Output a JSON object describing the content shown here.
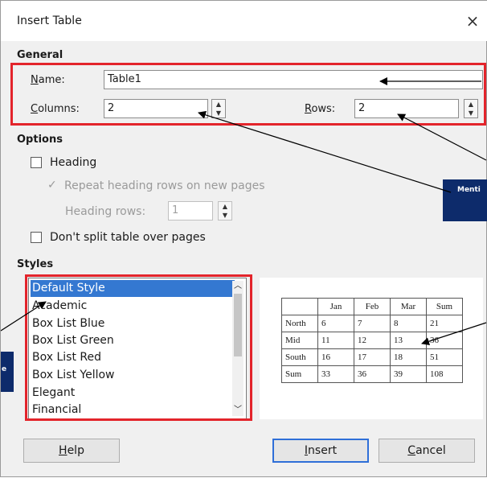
{
  "window": {
    "title": "Insert Table",
    "close_glyph": "×"
  },
  "general": {
    "heading": "General",
    "name_label": "Name:",
    "name_value": "Table1",
    "columns_label": "Columns:",
    "columns_value": "2",
    "rows_label": "Rows:",
    "rows_value": "2"
  },
  "options": {
    "heading": "Options",
    "heading_checkbox": "Heading",
    "repeat_heading": "Repeat heading rows on new pages",
    "heading_rows_label": "Heading rows:",
    "heading_rows_value": "1",
    "dont_split": "Don't split table over pages"
  },
  "styles": {
    "heading": "Styles",
    "items": [
      "Default Style",
      "Academic",
      "Box List Blue",
      "Box List Green",
      "Box List Red",
      "Box List Yellow",
      "Elegant",
      "Financial"
    ],
    "selected": "Default Style"
  },
  "preview_table": {
    "header": [
      "",
      "Jan",
      "Feb",
      "Mar",
      "Sum"
    ],
    "rows": [
      [
        "North",
        "6",
        "7",
        "8",
        "21"
      ],
      [
        "Mid",
        "11",
        "12",
        "13",
        "36"
      ],
      [
        "South",
        "16",
        "17",
        "18",
        "51"
      ],
      [
        "Sum",
        "33",
        "36",
        "39",
        "108"
      ]
    ]
  },
  "buttons": {
    "help": "Help",
    "insert": "Insert",
    "cancel": "Cancel"
  },
  "annotations": {
    "callout_right": "Menti",
    "callout_left": "e"
  },
  "colors": {
    "highlight_red": "#e3242b",
    "selection_blue": "#3478d1",
    "callout_navy": "#0d2b6b"
  }
}
